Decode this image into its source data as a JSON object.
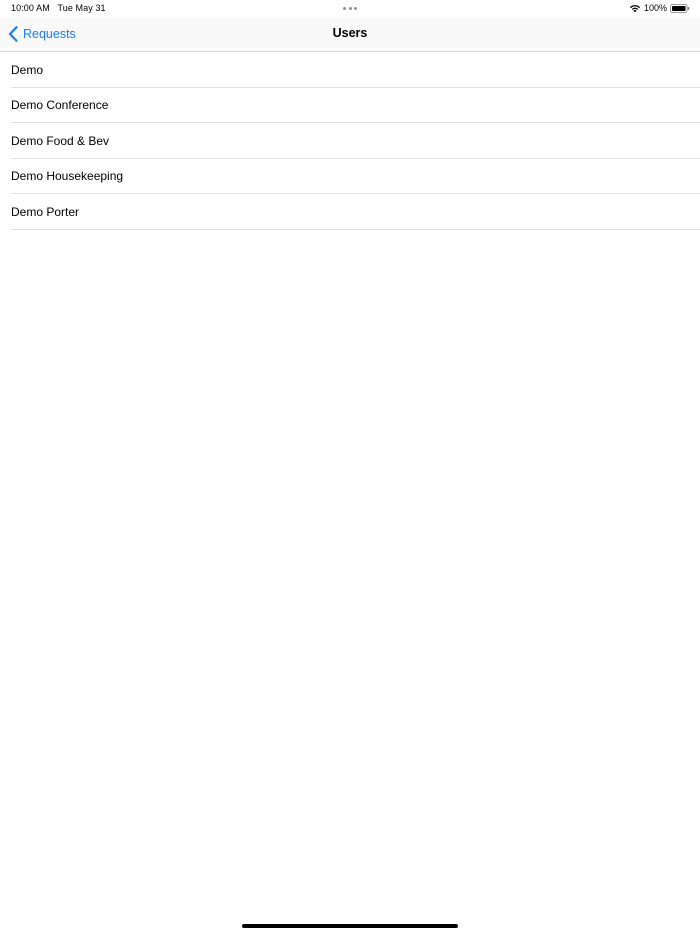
{
  "status_bar": {
    "time": "10:00 AM",
    "date": "Tue May 31",
    "battery": "100%"
  },
  "nav": {
    "back_label": "Requests",
    "title": "Users",
    "back_icon": "chevron-left-icon"
  },
  "users": [
    {
      "name": "Demo"
    },
    {
      "name": "Demo Conference"
    },
    {
      "name": "Demo Food & Bev"
    },
    {
      "name": "Demo Housekeeping"
    },
    {
      "name": "Demo Porter"
    }
  ],
  "colors": {
    "accent": "#1a7cf4",
    "separator": "#e2e2e4",
    "nav_background": "#f9f9f9"
  }
}
